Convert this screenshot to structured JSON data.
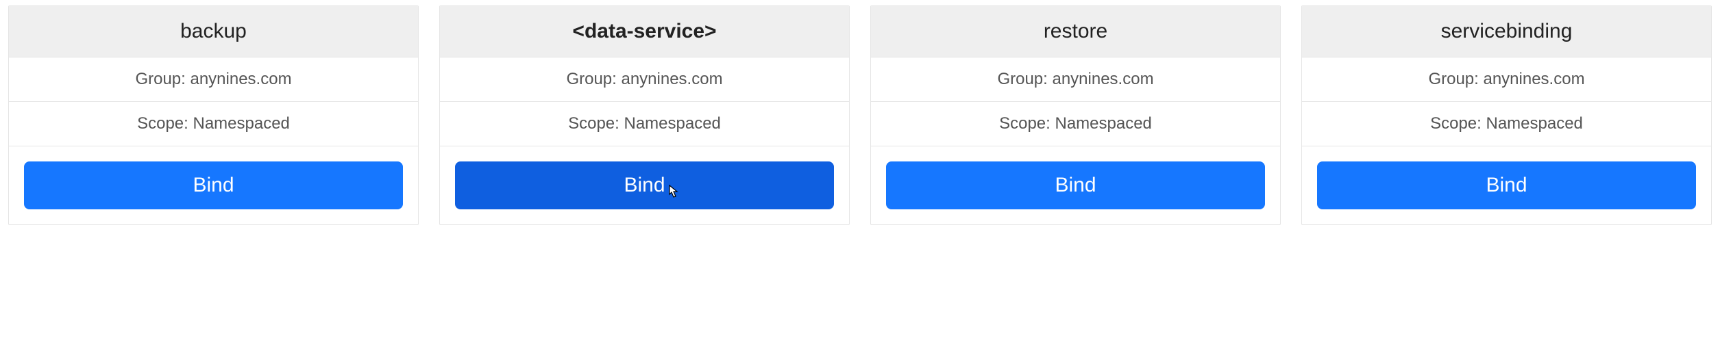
{
  "labels": {
    "group_prefix": "Group: ",
    "scope_prefix": "Scope: "
  },
  "cards": [
    {
      "title": "backup",
      "group": "anynines.com",
      "scope": "Namespaced",
      "button_label": "Bind",
      "bold_title": false,
      "hover": false
    },
    {
      "title": "<data-service>",
      "group": "anynines.com",
      "scope": "Namespaced",
      "button_label": "Bind",
      "bold_title": true,
      "hover": true
    },
    {
      "title": "restore",
      "group": "anynines.com",
      "scope": "Namespaced",
      "button_label": "Bind",
      "bold_title": false,
      "hover": false
    },
    {
      "title": "servicebinding",
      "group": "anynines.com",
      "scope": "Namespaced",
      "button_label": "Bind",
      "bold_title": false,
      "hover": false
    }
  ]
}
